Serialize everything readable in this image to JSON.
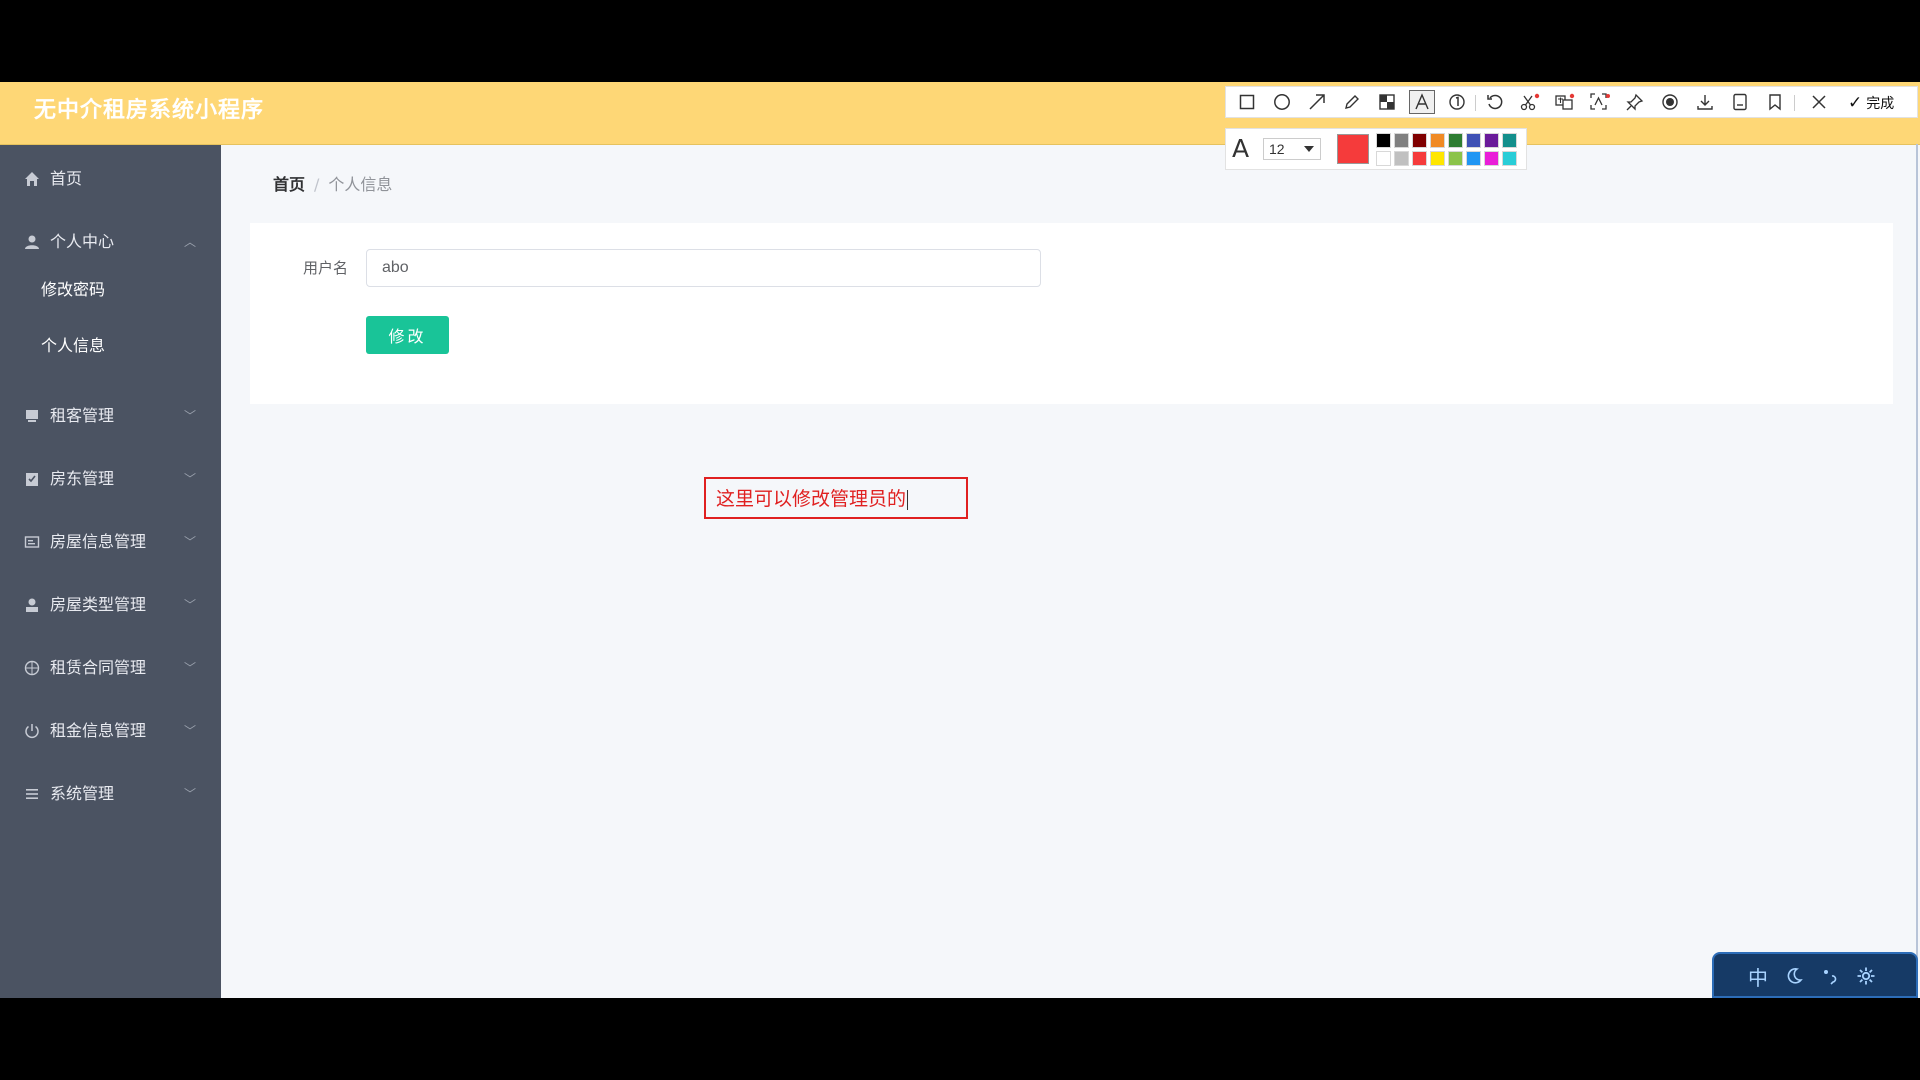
{
  "app": {
    "title": "无中介租房系统小程序"
  },
  "sidebar": {
    "items": [
      {
        "label": "首页",
        "icon": "home-icon"
      },
      {
        "label": "个人中心",
        "icon": "user-icon",
        "expanded": true,
        "children": [
          {
            "label": "修改密码"
          },
          {
            "label": "个人信息"
          }
        ]
      },
      {
        "label": "租客管理",
        "icon": "tenant-icon"
      },
      {
        "label": "房东管理",
        "icon": "landlord-icon"
      },
      {
        "label": "房屋信息管理",
        "icon": "house-info-icon"
      },
      {
        "label": "房屋类型管理",
        "icon": "house-type-icon"
      },
      {
        "label": "租赁合同管理",
        "icon": "contract-icon"
      },
      {
        "label": "租金信息管理",
        "icon": "rent-icon"
      },
      {
        "label": "系统管理",
        "icon": "system-icon"
      }
    ]
  },
  "breadcrumb": {
    "home": "首页",
    "separator": "/",
    "current": "个人信息"
  },
  "form": {
    "username_label": "用户名",
    "username_value": "abo",
    "submit_label": "修改"
  },
  "annotation": {
    "text": "这里可以修改管理员的",
    "color": "#e02020"
  },
  "snip_toolbar": {
    "tools": [
      "rectangle-icon",
      "ellipse-icon",
      "arrow-icon",
      "pencil-icon",
      "mosaic-icon",
      "text-icon",
      "number-marker-icon",
      "undo-icon",
      "scissors-ai-icon",
      "translate-icon",
      "ocr-icon",
      "pin-icon",
      "record-icon",
      "download-icon",
      "save-icon",
      "bookmark-icon",
      "close-icon"
    ],
    "active_tool": "text-icon",
    "done_label": "完成",
    "font_size": "12",
    "current_color": "#f53b3b",
    "palette": [
      "#000000",
      "#808080",
      "#800000",
      "#f08a24",
      "#2e7d32",
      "#3f51b5",
      "#6a1b9a",
      "#138f8c",
      "#ffffff",
      "#c0c0c0",
      "#f53b3b",
      "#ffe600",
      "#8bc34a",
      "#2196f3",
      "#e91ed8",
      "#29cdd7"
    ]
  },
  "ime": {
    "language_label": "中"
  },
  "colors": {
    "header": "#fed776",
    "sidebar": "#4b5362",
    "primary_button": "#19c498",
    "background": "#f5f7fa"
  }
}
